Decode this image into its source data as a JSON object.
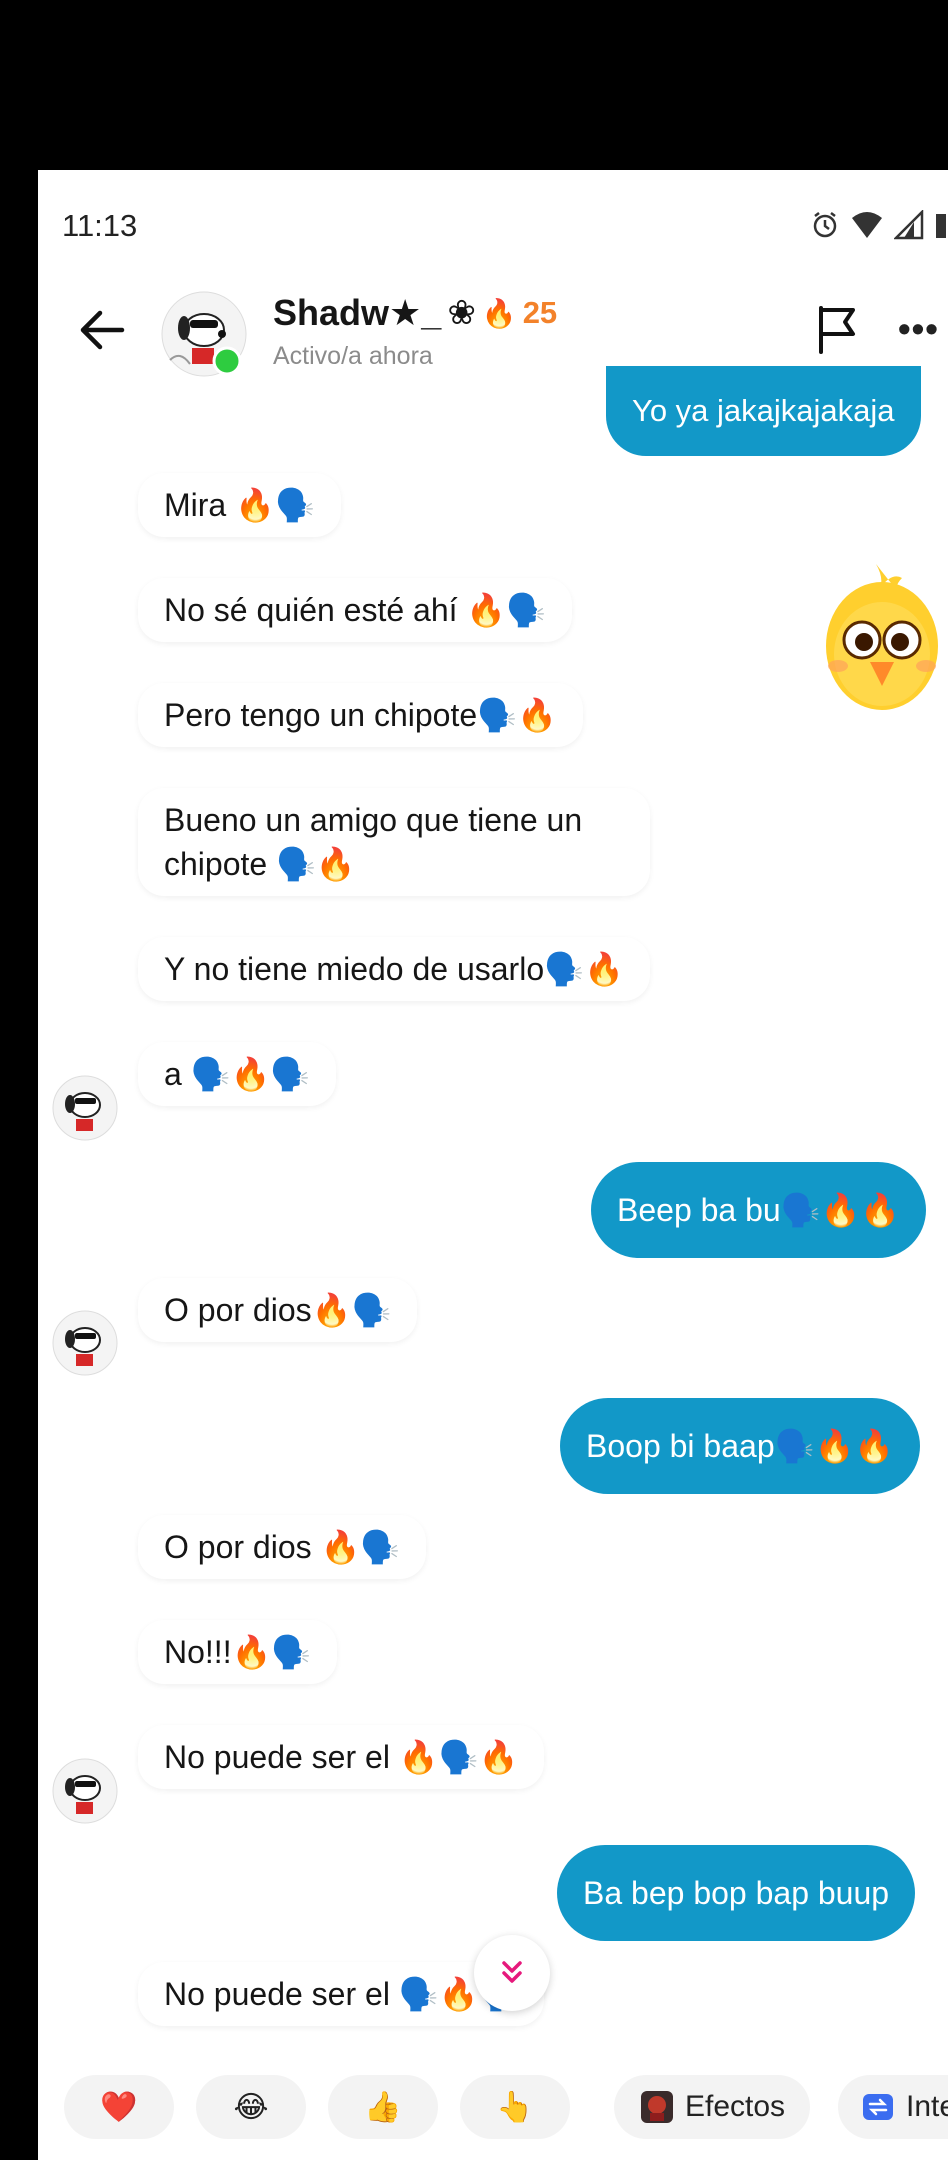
{
  "status_bar": {
    "time": "11:13"
  },
  "header": {
    "contact_name": "Shadw★_",
    "name_symbol": "❀",
    "streak_icon": "fire-icon",
    "streak_count": "25",
    "presence": "Activo/a ahora",
    "online_color": "#2ecc40"
  },
  "colors": {
    "outgoing_bubble": "#1298c8",
    "accent_pink": "#e6197c"
  },
  "messages": [
    {
      "dir": "out",
      "text": "Yo ya jakajkajakaja",
      "avatar": false
    },
    {
      "dir": "in",
      "text": "Mira 🔥🗣️",
      "avatar": false
    },
    {
      "dir": "in",
      "text": "No sé quién esté ahí 🔥🗣️",
      "avatar": false
    },
    {
      "dir": "in",
      "text": "Pero tengo un chipote🗣️🔥",
      "avatar": false
    },
    {
      "dir": "in",
      "text": "Bueno un amigo que tiene un chipote 🗣️🔥",
      "avatar": false
    },
    {
      "dir": "in",
      "text": "Y no tiene miedo de usarlo🗣️🔥",
      "avatar": false
    },
    {
      "dir": "in",
      "text": "a 🗣️🔥🗣️",
      "avatar": true
    },
    {
      "dir": "out",
      "text": "Beep ba bu🗣️🔥🔥",
      "avatar": false
    },
    {
      "dir": "in",
      "text": "O por dios🔥🗣️",
      "avatar": true
    },
    {
      "dir": "out",
      "text": "Boop bi baap🗣️🔥🔥",
      "avatar": false
    },
    {
      "dir": "in",
      "text": "O por dios 🔥🗣️",
      "avatar": false
    },
    {
      "dir": "in",
      "text": "No!!!🔥🗣️",
      "avatar": false
    },
    {
      "dir": "in",
      "text": "No puede ser el 🔥🗣️🔥",
      "avatar": true
    },
    {
      "dir": "out",
      "text": "Ba bep bop bap buup",
      "avatar": false
    },
    {
      "dir": "in",
      "text": "No puede ser el 🗣️🔥🗣️",
      "avatar": false
    }
  ],
  "quick_reactions": {
    "items": [
      {
        "icon": "heart-icon",
        "glyph": "❤️"
      },
      {
        "icon": "laughing-icon",
        "glyph": "😂"
      },
      {
        "icon": "thumbs-up-icon",
        "glyph": "👍"
      },
      {
        "icon": "pointing-hand-icon",
        "glyph": "👆"
      }
    ],
    "effects_label": "Efectos",
    "effects_icon": "effects-icon",
    "interactions_label": "Inte",
    "interactions_icon": "interactions-icon"
  },
  "scroll_button_icon": "chevron-double-down-icon",
  "sticker_icon": "yellow-chick-sticker-icon"
}
